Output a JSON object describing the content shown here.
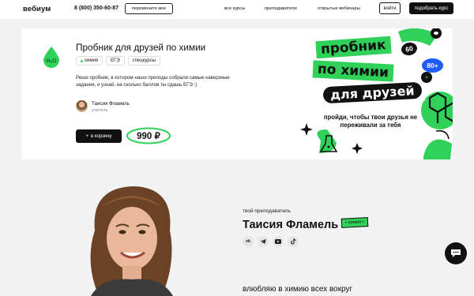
{
  "header": {
    "logo": "вебиум",
    "phone": "8 (800) 350-60-87",
    "callback_label": "перезвоните мне",
    "nav": [
      "все курсы",
      "преподаватели",
      "открытые вебинары"
    ],
    "login_label": "войти",
    "buy_label": "подобрать курс"
  },
  "product": {
    "title": "Пробник для друзей по химии",
    "tags": [
      "химия",
      "ЕГЭ",
      "спецкурсы"
    ],
    "description": "Реши пробник, в котором наши преподы собрали самые каверзные задания, и узнай, на сколько баллов ты сдашь ЕГЭ :)",
    "author_name": "Таисия Фламель",
    "author_role": "учитель",
    "cart_label": "в корзину",
    "price": "990 ₽"
  },
  "promo": {
    "line1": "пробник",
    "line2": "по химии",
    "line3": "для друзей",
    "subtitle": "пройди, чтобы твои друзья не переживали за тебя",
    "badge1": "60",
    "badge2": "80+"
  },
  "teacher": {
    "label": "твой преподаватель",
    "name": "Таисия Фламель",
    "subject": "химия",
    "socials": [
      "vk",
      "telegram",
      "youtube",
      "tiktok"
    ],
    "quote": "влюбляю в химию всех вокруг"
  },
  "colors": {
    "accent_green": "#2fd158",
    "dark": "#111111",
    "accent_blue": "#1f5cff",
    "page_bg": "#f2f2f2"
  }
}
